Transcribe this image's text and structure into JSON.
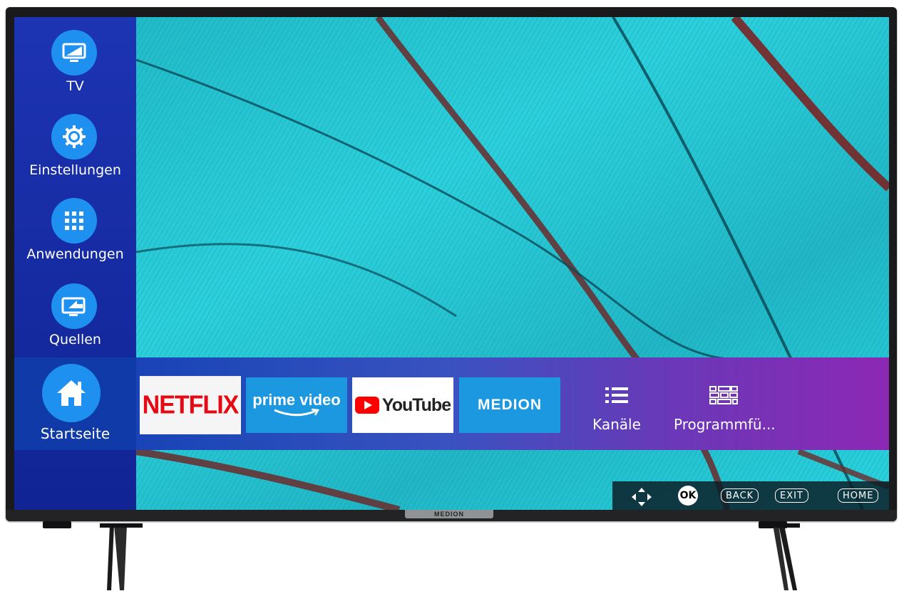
{
  "sidebar": {
    "items": [
      {
        "label": "TV",
        "icon": "tv-icon"
      },
      {
        "label": "Einstellungen",
        "icon": "gear-icon"
      },
      {
        "label": "Anwendungen",
        "icon": "grid-icon"
      },
      {
        "label": "Quellen",
        "icon": "source-input-icon"
      }
    ]
  },
  "home_bar": {
    "home": {
      "label": "Startseite",
      "icon": "home-icon"
    },
    "tiles": [
      {
        "label": "NETFLIX"
      },
      {
        "label": "prime video"
      },
      {
        "label": "YouTube"
      },
      {
        "label": "MEDION"
      }
    ],
    "extras": [
      {
        "label": "Kanäle",
        "icon": "list-icon"
      },
      {
        "label": "Programmfü...",
        "icon": "epg-guide-icon"
      }
    ]
  },
  "controls": {
    "ok": "OK",
    "back": "BACK",
    "exit": "EXIT",
    "home": "HOME"
  },
  "tv": {
    "brand": "MEDION"
  },
  "colors": {
    "sidebar": "#1d34b3",
    "icon_circle": "#1e90f0",
    "wallpaper_cyan": "#27c6d3",
    "netflix_red": "#e50914",
    "youtube_red": "#ff0000"
  }
}
